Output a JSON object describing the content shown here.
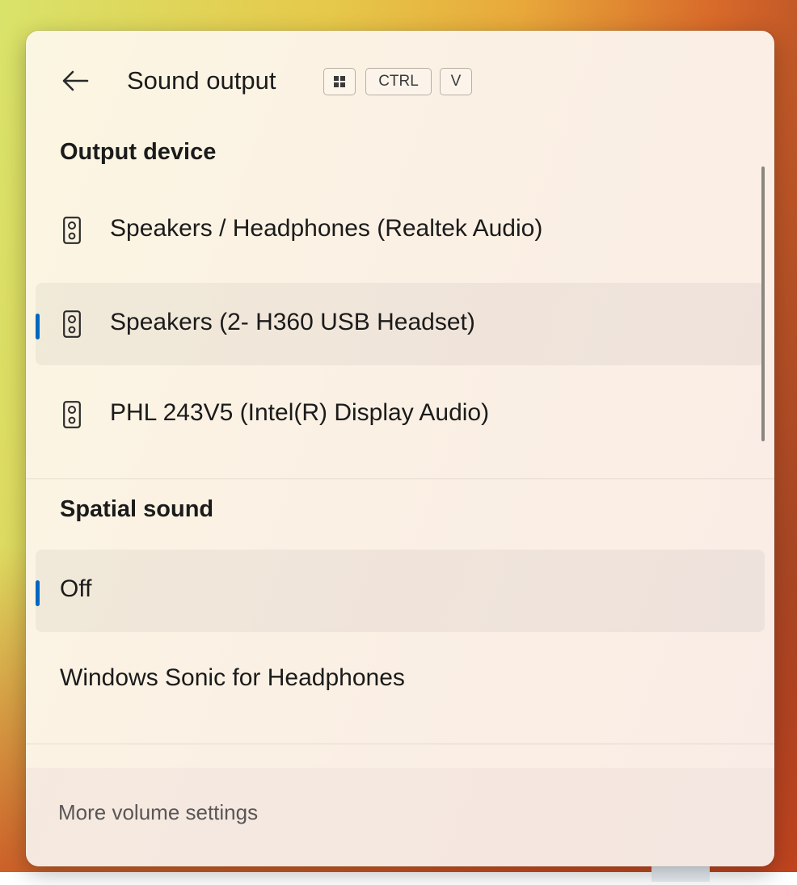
{
  "header": {
    "title": "Sound output",
    "back_icon": "arrow-left-icon",
    "shortcut_keys": [
      {
        "type": "icon",
        "icon": "windows-key-icon"
      },
      {
        "type": "text",
        "label": "CTRL"
      },
      {
        "type": "text",
        "label": "V"
      }
    ]
  },
  "output_device": {
    "heading": "Output device",
    "items": [
      {
        "label": "Speakers / Headphones (Realtek Audio)",
        "icon": "speaker-icon",
        "selected": false
      },
      {
        "label": "Speakers (2- H360 USB Headset)",
        "icon": "speaker-icon",
        "selected": true
      },
      {
        "label": "PHL 243V5 (Intel(R) Display Audio)",
        "icon": "speaker-icon",
        "selected": false
      }
    ]
  },
  "spatial_sound": {
    "heading": "Spatial sound",
    "items": [
      {
        "label": "Off",
        "selected": true
      },
      {
        "label": "Windows Sonic for Headphones",
        "selected": false
      }
    ]
  },
  "footer": {
    "link": "More volume settings"
  },
  "colors": {
    "accent": "#0067c0",
    "panel_bg": "#fbf3e4",
    "text": "#1b1b1b",
    "footer_text": "#5a5656"
  }
}
